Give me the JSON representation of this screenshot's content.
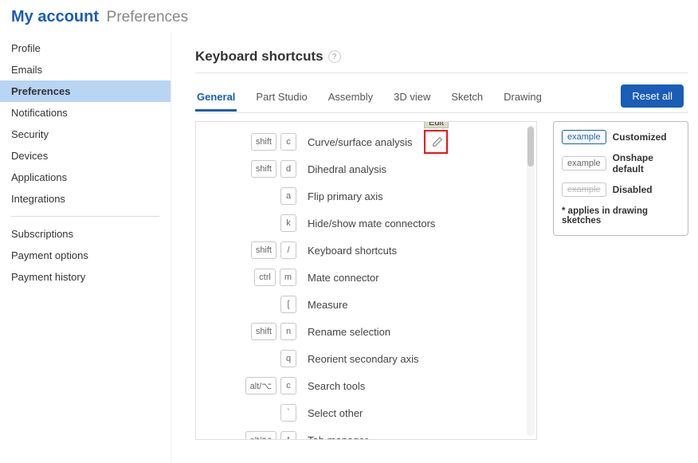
{
  "header": {
    "main": "My account",
    "sub": "Preferences"
  },
  "sidebar": {
    "group1": [
      {
        "label": "Profile",
        "active": false
      },
      {
        "label": "Emails",
        "active": false
      },
      {
        "label": "Preferences",
        "active": true
      },
      {
        "label": "Notifications",
        "active": false
      },
      {
        "label": "Security",
        "active": false
      },
      {
        "label": "Devices",
        "active": false
      },
      {
        "label": "Applications",
        "active": false
      },
      {
        "label": "Integrations",
        "active": false
      }
    ],
    "group2": [
      {
        "label": "Subscriptions"
      },
      {
        "label": "Payment options"
      },
      {
        "label": "Payment history"
      }
    ]
  },
  "section": {
    "title": "Keyboard shortcuts"
  },
  "tabs": [
    {
      "label": "General",
      "active": true
    },
    {
      "label": "Part Studio"
    },
    {
      "label": "Assembly"
    },
    {
      "label": "3D view"
    },
    {
      "label": "Sketch"
    },
    {
      "label": "Drawing"
    }
  ],
  "reset_label": "Reset all",
  "tooltip_edit": "Edit",
  "shortcuts": [
    {
      "keys": [
        "shift",
        "c"
      ],
      "label": "Curve/surface analysis",
      "show_edit": true
    },
    {
      "keys": [
        "shift",
        "d"
      ],
      "label": "Dihedral analysis"
    },
    {
      "keys": [
        "a"
      ],
      "label": "Flip primary axis"
    },
    {
      "keys": [
        "k"
      ],
      "label": "Hide/show mate connectors"
    },
    {
      "keys": [
        "shift",
        "/"
      ],
      "label": "Keyboard shortcuts"
    },
    {
      "keys": [
        "ctrl",
        "m"
      ],
      "label": "Mate connector"
    },
    {
      "keys": [
        "["
      ],
      "label": "Measure"
    },
    {
      "keys": [
        "shift",
        "n"
      ],
      "label": "Rename selection"
    },
    {
      "keys": [
        "q"
      ],
      "label": "Reorient secondary axis"
    },
    {
      "keys": [
        "alt/⌥",
        "c"
      ],
      "label": "Search tools"
    },
    {
      "keys": [
        "`"
      ],
      "label": "Select other"
    },
    {
      "keys": [
        "alt/⌥",
        "t"
      ],
      "label": "Tab manager"
    }
  ],
  "legend": {
    "custom": {
      "key": "example",
      "label": "Customized"
    },
    "default": {
      "key": "example",
      "label": "Onshape default"
    },
    "disabled": {
      "key": "example",
      "label": "Disabled"
    },
    "note": "* applies in drawing sketches"
  }
}
